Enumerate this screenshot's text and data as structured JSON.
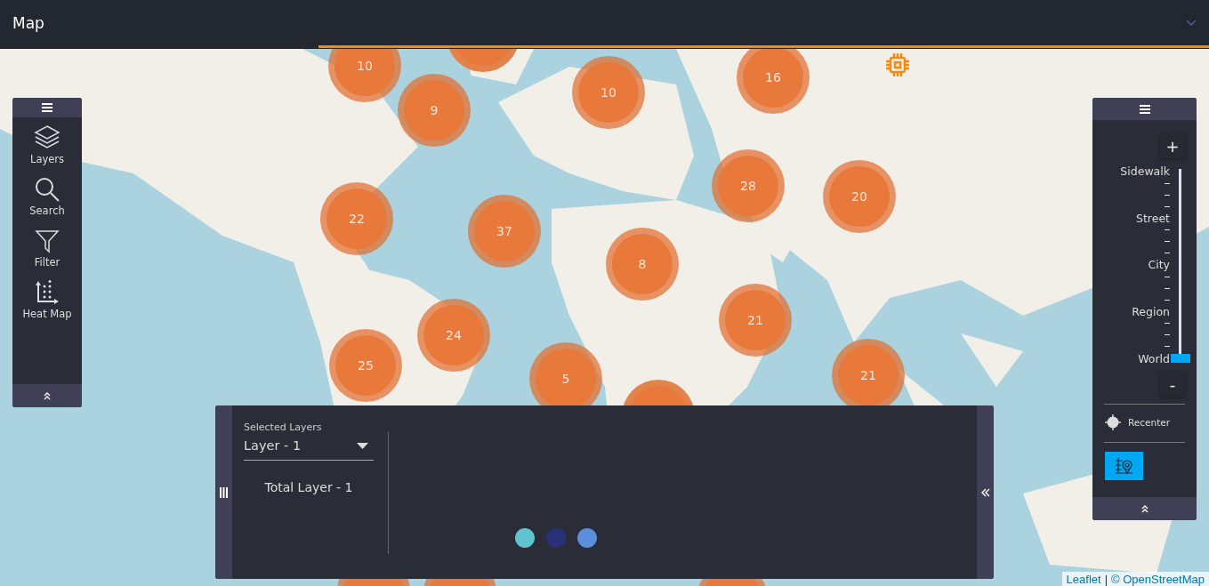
{
  "header": {
    "title": "Map"
  },
  "map": {
    "markers": [
      {
        "count": "10"
      },
      {
        "count": "9"
      },
      {
        "count": "10"
      },
      {
        "count": "16"
      },
      {
        "count": "22"
      },
      {
        "count": "37"
      },
      {
        "count": "8"
      },
      {
        "count": "28"
      },
      {
        "count": "20"
      },
      {
        "count": "21"
      },
      {
        "count": "24"
      },
      {
        "count": "25"
      },
      {
        "count": "5"
      },
      {
        "count": "21"
      }
    ],
    "attribution": {
      "link": "Leaflet",
      "separator": "|",
      "rest": "© OpenStreetMap"
    }
  },
  "toolbar": {
    "items": [
      {
        "label": "Layers",
        "kind": "layers"
      },
      {
        "label": "Search",
        "kind": "search"
      },
      {
        "label": "Filter",
        "kind": "filter"
      },
      {
        "label": "Heat Map",
        "kind": "heatmap"
      }
    ]
  },
  "zoom": {
    "plus": "+",
    "minus": "-",
    "levels": [
      "Sidewalk",
      "Street",
      "City",
      "Region",
      "World"
    ],
    "level": 0,
    "recenter": "Recenter"
  },
  "layers_panel": {
    "caption": "Selected Layers",
    "selected_layer": "Layer - 1",
    "total": "Total Layer - 1",
    "legend": [
      {
        "color": "#62c3d0"
      },
      {
        "color": "#283078"
      },
      {
        "color": "#5b8fdc"
      }
    ]
  }
}
